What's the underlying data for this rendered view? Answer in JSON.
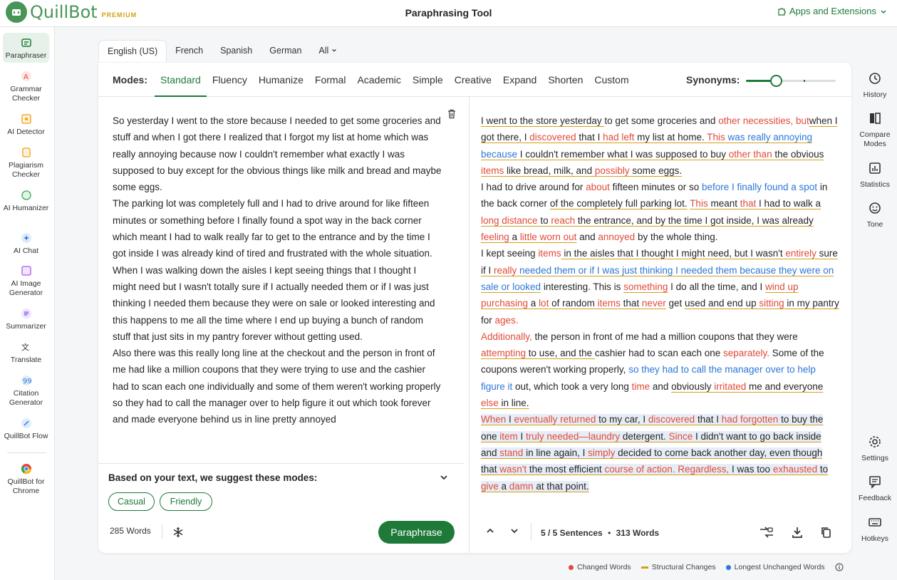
{
  "app": {
    "name": "QuillBot",
    "tier": "PREMIUM",
    "page_title": "Paraphrasing Tool",
    "apps_link": "Apps and Extensions"
  },
  "left_nav": [
    {
      "label": "Paraphraser",
      "icon": "paraphraser-icon",
      "active": true
    },
    {
      "label": "Grammar Checker",
      "icon": "grammar-checker-icon"
    },
    {
      "label": "AI Detector",
      "icon": "ai-detector-icon"
    },
    {
      "label": "Plagiarism Checker",
      "icon": "plagiarism-checker-icon"
    },
    {
      "label": "AI Humanizer",
      "icon": "ai-humanizer-icon"
    },
    {
      "label": "AI Chat",
      "icon": "ai-chat-icon"
    },
    {
      "label": "AI Image Generator",
      "icon": "ai-image-generator-icon"
    },
    {
      "label": "Summarizer",
      "icon": "summarizer-icon"
    },
    {
      "label": "Translate",
      "icon": "translate-icon"
    },
    {
      "label": "Citation Generator",
      "icon": "citation-icon"
    },
    {
      "label": "QuillBot Flow",
      "icon": "flow-icon"
    },
    {
      "label": "QuillBot for Chrome",
      "icon": "chrome-icon"
    }
  ],
  "right_nav": [
    {
      "label": "History",
      "icon": "history-icon"
    },
    {
      "label": "Compare Modes",
      "icon": "compare-modes-icon"
    },
    {
      "label": "Statistics",
      "icon": "statistics-icon"
    },
    {
      "label": "Tone",
      "icon": "tone-icon"
    },
    {
      "label": "Settings",
      "icon": "settings-icon"
    },
    {
      "label": "Feedback",
      "icon": "feedback-icon"
    },
    {
      "label": "Hotkeys",
      "icon": "hotkeys-icon"
    }
  ],
  "languages": [
    "English (US)",
    "French",
    "Spanish",
    "German",
    "All"
  ],
  "modes_label": "Modes:",
  "modes": [
    "Standard",
    "Fluency",
    "Humanize",
    "Formal",
    "Academic",
    "Simple",
    "Creative",
    "Expand",
    "Shorten",
    "Custom"
  ],
  "synonyms": {
    "label": "Synonyms:",
    "level": 0.33
  },
  "input_paragraphs": [
    "So yesterday I went to the store because I needed to get some groceries and stuff and when I got there I realized that I forgot my list at home which was really annoying because now I couldn't remember what exactly I was supposed to buy except for the obvious things like milk and bread and maybe some eggs.",
    "The parking lot was completely full and I had to drive around for like fifteen minutes or something before I finally found a spot way in the back corner which meant I had to walk really far to get to the entrance and by the time I got inside I was already kind of tired and frustrated with the whole situation.",
    "When I was walking down the aisles I kept seeing things that I thought I might need but I wasn't totally sure if I actually needed them or if I was just thinking I needed them because they were on sale or looked interesting and this happens to me all the time where I end up buying a bunch of random stuff that just sits in my pantry forever without getting used.",
    "Also there was this really long line at the checkout and the person in front of me had like a million coupons that they were trying to use and the cashier had to scan each one individually and some of them weren't working properly so they had to call the manager over to help figure it out which took forever and made everyone behind us in line pretty annoyed"
  ],
  "suggest": {
    "title": "Based on your text, we suggest these modes:",
    "chips": [
      "Casual",
      "Friendly"
    ]
  },
  "input_footer": {
    "words": "285 Words",
    "button": "Paraphrase"
  },
  "output_paragraphs": [
    [
      [
        "s",
        "I went to the store yesterday "
      ],
      [
        "",
        "to get some groceries and "
      ],
      [
        "c",
        "other necessities, but"
      ],
      [
        "",
        "\n"
      ],
      [
        "s",
        "when I got there, I "
      ],
      [
        "cs",
        "discovered"
      ],
      [
        "s",
        " that I "
      ],
      [
        "cs",
        "had left"
      ],
      [
        "s",
        " my list at home. "
      ],
      [
        "cs",
        "This"
      ],
      [
        "s",
        " "
      ],
      [
        "ls",
        "was really annoying because"
      ],
      [
        "s",
        " I couldn't remember what I was"
      ],
      [
        "s",
        " supposed to buy "
      ],
      [
        "cs",
        "other than"
      ],
      [
        "s",
        " the obvious "
      ],
      [
        "cs",
        "items"
      ],
      [
        "s",
        " like bread, milk, and "
      ],
      [
        "cs",
        "possibly"
      ],
      [
        "s",
        " some eggs."
      ]
    ],
    [
      [
        "",
        "I had to drive around for "
      ],
      [
        "c",
        "about"
      ],
      [
        "",
        " fifteen minutes or so "
      ],
      [
        "l",
        "before I finally found a spot"
      ],
      [
        "",
        " in the back corner "
      ],
      [
        "s",
        "of the completely full parking lot."
      ],
      [
        "",
        " "
      ],
      [
        "cs",
        "This"
      ],
      [
        "s",
        " meant "
      ],
      [
        "cs",
        "that"
      ],
      [
        "s",
        " I had to walk a "
      ],
      [
        "cs",
        "long distance"
      ],
      [
        "s",
        " to "
      ],
      [
        "cs",
        "reach"
      ],
      [
        "s",
        " the entrance, and by the time I got inside, I was already "
      ],
      [
        "cs",
        "feeling"
      ],
      [
        "s",
        " a "
      ],
      [
        "cs",
        "little worn out"
      ],
      [
        "",
        " and "
      ],
      [
        "c",
        "annoyed"
      ],
      [
        "",
        " by the whole thing."
      ]
    ],
    [
      [
        "",
        "I kept seeing "
      ],
      [
        "c",
        "items"
      ],
      [
        "s",
        " in the aisles that I thought I might need, but I wasn't "
      ],
      [
        "cs",
        "entirely"
      ],
      [
        "s",
        " sure if I "
      ],
      [
        "cs",
        "really"
      ],
      [
        "ls",
        " needed them or if I was just thinking I needed them because they were on sale or looked"
      ],
      [
        "",
        " interesting. This is "
      ],
      [
        "cs",
        "something"
      ],
      [
        "",
        " I do all the time, and I "
      ],
      [
        "cs",
        "wind up"
      ],
      [
        "s",
        " "
      ],
      [
        "cs",
        "purchasing"
      ],
      [
        "s",
        " a "
      ],
      [
        "cs",
        "lot"
      ],
      [
        "s",
        " of random "
      ],
      [
        "cs",
        "items"
      ],
      [
        "s",
        " that "
      ],
      [
        "cs",
        "never"
      ],
      [
        "",
        " get "
      ],
      [
        "s",
        "used and end up "
      ],
      [
        "cs",
        "sitting"
      ],
      [
        "s",
        " in my pantry"
      ],
      [
        "",
        " for "
      ],
      [
        "c",
        "ages."
      ]
    ],
    [
      [
        "c",
        "Additionally,"
      ],
      [
        "",
        " the person in front of me had a million coupons that they were "
      ],
      [
        "cs",
        "attempting"
      ],
      [
        "s",
        " to use, and the "
      ],
      [
        "",
        " cashier had to scan each one "
      ],
      [
        "c",
        "separately."
      ],
      [
        "",
        " Some of the coupons weren't working properly, "
      ],
      [
        "l",
        "so they had to call the manager over to help figure it"
      ],
      [
        "",
        " out, which took a very long "
      ],
      [
        "c",
        "time"
      ],
      [
        "",
        " and "
      ],
      [
        "s",
        "obviously "
      ],
      [
        "cs",
        "irritated"
      ],
      [
        "s",
        " me and everyone "
      ],
      [
        "cs",
        "else"
      ],
      [
        "s",
        " in line."
      ]
    ],
    [
      [
        "hc",
        "When"
      ],
      [
        "h",
        " I "
      ],
      [
        "hc",
        "eventually returned"
      ],
      [
        "h",
        " to my car, I "
      ],
      [
        "hc",
        "discovered"
      ],
      [
        "h",
        " that I "
      ],
      [
        "hc",
        "had forgotten"
      ],
      [
        "h",
        " to buy the one "
      ],
      [
        "hc",
        "item"
      ],
      [
        "h",
        " I "
      ],
      [
        "hc",
        "truly needed—laundry"
      ],
      [
        "h",
        " detergent. "
      ],
      [
        "hc",
        "Since"
      ],
      [
        "h",
        " I didn't want to go back inside and "
      ],
      [
        "hc",
        "stand"
      ],
      [
        "h",
        " in line again, I "
      ],
      [
        "hc",
        "simply"
      ],
      [
        "h",
        " decided to come back another day, even though that "
      ],
      [
        "hc",
        "wasn't"
      ],
      [
        "h",
        " the most efficient "
      ],
      [
        "hc",
        "course of action. Regardless,"
      ],
      [
        "h",
        " I was too "
      ],
      [
        "hc",
        "exhausted"
      ],
      [
        "h",
        " to "
      ],
      [
        "hc",
        "give"
      ],
      [
        "h",
        " a "
      ],
      [
        "hc",
        "damn"
      ],
      [
        "h",
        " at that point."
      ]
    ]
  ],
  "output_footer": {
    "sentences": "5 / 5 Sentences",
    "bullet": "•",
    "words": "313 Words"
  },
  "legend": [
    "Changed Words",
    "Structural Changes",
    "Longest Unchanged Words"
  ],
  "colors": {
    "brand": "#1f7a3a",
    "changed": "#e04a39",
    "structural": "#d4a017",
    "unchanged": "#2d77d8"
  }
}
